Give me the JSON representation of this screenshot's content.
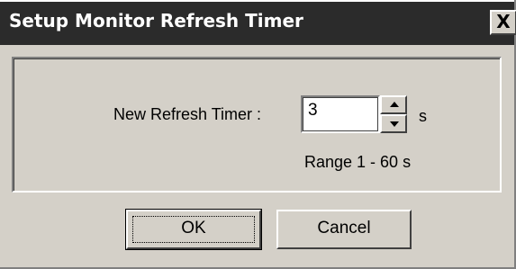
{
  "window": {
    "title": "Setup Monitor Refresh Timer",
    "close_label": "X"
  },
  "form": {
    "field_label": "New Refresh Timer :",
    "value": "3",
    "unit": "s",
    "range_text": "Range 1 - 60 s"
  },
  "buttons": {
    "ok_label": "OK",
    "cancel_label": "Cancel"
  },
  "icons": {
    "close": "close-icon",
    "spin_up": "arrow-up-icon",
    "spin_down": "arrow-down-icon"
  },
  "colors": {
    "titlebar": "#2b2b2b",
    "title_text": "#ffffff",
    "dialog_face": "#d4d0c8"
  }
}
